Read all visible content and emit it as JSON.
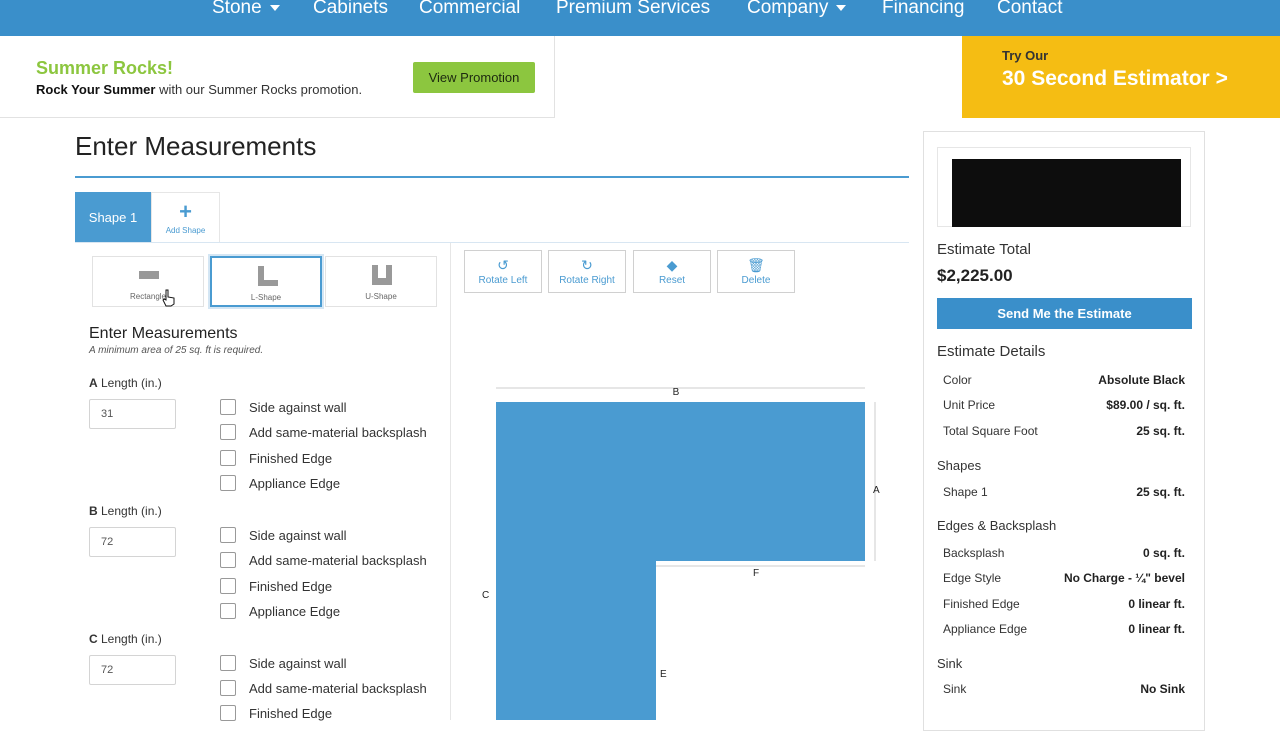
{
  "nav": {
    "items": [
      "Stone",
      "Cabinets",
      "Commercial",
      "Premium Services",
      "Company",
      "Financing",
      "Contact"
    ]
  },
  "promo": {
    "title": "Summer Rocks!",
    "text_bold": "Rock Your Summer",
    "text_rest": " with our Summer Rocks promotion.",
    "button": "View Promotion"
  },
  "estimator_banner": {
    "kicker": "Try Our",
    "link": "30 Second Estimator >"
  },
  "page": {
    "heading": "Enter Measurements"
  },
  "tabs": {
    "shape1": "Shape 1",
    "add_shape": "Add Shape"
  },
  "shapes": [
    "Rectangle",
    "L-Shape",
    "U-Shape"
  ],
  "selected_shape": "L-Shape",
  "toolbar": [
    "Rotate Left",
    "Rotate Right",
    "Reset",
    "Delete"
  ],
  "form": {
    "title": "Enter Measurements",
    "note": "A minimum area of 25 sq. ft is required.",
    "lengths": [
      {
        "letter": "A",
        "label": " Length (in.)",
        "value": "31"
      },
      {
        "letter": "B",
        "label": " Length (in.)",
        "value": "72"
      },
      {
        "letter": "C",
        "label": " Length (in.)",
        "value": "72"
      }
    ],
    "options": [
      "Side against wall",
      "Add same-material backsplash",
      "Finished Edge",
      "Appliance Edge"
    ]
  },
  "diagram": {
    "color": "#4a9bd1",
    "labels": [
      "A",
      "B",
      "C",
      "E",
      "F"
    ]
  },
  "sidebar": {
    "total_label": "Estimate Total",
    "total": "$2,225.00",
    "send_button": "Send Me the Estimate",
    "details_title": "Estimate Details",
    "details": [
      {
        "k": "Color",
        "v": "Absolute Black"
      },
      {
        "k": "Unit Price",
        "v": "$89.00 / sq. ft."
      },
      {
        "k": "Total Square Foot",
        "v": "25 sq. ft."
      }
    ],
    "shapes_title": "Shapes",
    "shapes": [
      {
        "k": "Shape 1",
        "v": "25 sq. ft."
      }
    ],
    "edges_title": "Edges & Backsplash",
    "edges": [
      {
        "k": "Backsplash",
        "v": "0 sq. ft."
      },
      {
        "k": "Edge Style",
        "v": "No Charge - ¼\" bevel"
      },
      {
        "k": "Finished Edge",
        "v": "0 linear ft."
      },
      {
        "k": "Appliance Edge",
        "v": "0 linear ft."
      }
    ],
    "sink_title": "Sink",
    "sink": [
      {
        "k": "Sink",
        "v": "No Sink"
      }
    ]
  },
  "colors": {
    "brand_blue": "#3a8fca",
    "promo_green": "#8cc63f",
    "banner_yellow": "#f5bd13"
  }
}
